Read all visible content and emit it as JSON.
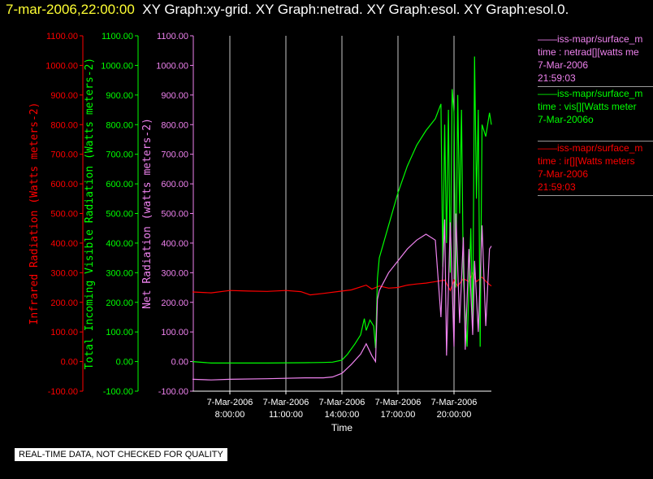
{
  "header": {
    "date_time": "7-mar-2006,22:00:00",
    "graphs": "XY Graph:xy-grid.  XY Graph:netrad.  XY Graph:esol.  XY Graph:esol.0."
  },
  "quality_note": "REAL-TIME DATA, NOT CHECKED FOR QUALITY",
  "legend": [
    {
      "lines": [
        "——iss-mapr/surface_m",
        "time : netrad[][watts me",
        "7-Mar-2006",
        "21:59:03"
      ],
      "color": "#ee82ee"
    },
    {
      "lines": [
        "——iss-mapr/surface_m",
        "time : vis[][Watts meter",
        "7-Mar-2006o"
      ],
      "color": "#00ff00"
    },
    {
      "lines": [
        "——iss-mapr/surface_m",
        "time : ir[][Watts meters",
        "7-Mar-2006",
        "21:59:03"
      ],
      "color": "#ff0000"
    }
  ],
  "chart_data": {
    "type": "line",
    "xlabel": "Time",
    "x_ticks": [
      {
        "hour": 8,
        "date": "7-Mar-2006",
        "time": "8:00:00"
      },
      {
        "hour": 11,
        "date": "7-Mar-2006",
        "time": "11:00:00"
      },
      {
        "hour": 14,
        "date": "7-Mar-2006",
        "time": "14:00:00"
      },
      {
        "hour": 17,
        "date": "7-Mar-2006",
        "time": "17:00:00"
      },
      {
        "hour": 20,
        "date": "7-Mar-2006",
        "time": "20:00:00"
      }
    ],
    "xlim": [
      6.0,
      22.0
    ],
    "grid_x": true,
    "axes": [
      {
        "id": "ir",
        "label": "Infrared Radiation (Watts meters-2)",
        "color": "#ff0000",
        "ylim": [
          -100,
          1100
        ],
        "ticks": [
          "-100.00",
          "0.00",
          "100.00",
          "200.00",
          "300.00",
          "400.00",
          "500.00",
          "600.00",
          "700.00",
          "800.00",
          "900.00",
          "1000.00",
          "1100.00"
        ]
      },
      {
        "id": "vis",
        "label": "Total Incoming Visible Radiation (Watts meters-2)",
        "color": "#00ff00",
        "ylim": [
          -100,
          1100
        ],
        "ticks": [
          "-100.00",
          "0.00",
          "100.00",
          "200.00",
          "300.00",
          "400.00",
          "500.00",
          "600.00",
          "700.00",
          "800.00",
          "900.00",
          "1000.00",
          "1100.00"
        ]
      },
      {
        "id": "netrad",
        "label": "Net Radiation (watts meters-2)",
        "color": "#ee82ee",
        "ylim": [
          -100,
          1100
        ],
        "ticks": [
          "-100.00",
          "0.00",
          "100.00",
          "200.00",
          "300.00",
          "400.00",
          "500.00",
          "600.00",
          "700.00",
          "800.00",
          "900.00",
          "1000.00",
          "1100.00"
        ]
      }
    ],
    "series": [
      {
        "name": "ir",
        "color": "#ff0000",
        "x": [
          6.0,
          7.0,
          8.0,
          9.0,
          10.0,
          11.0,
          11.8,
          12.3,
          13.0,
          14.0,
          14.5,
          15.0,
          15.3,
          15.6,
          16.0,
          16.5,
          17.0,
          17.5,
          18.0,
          18.5,
          19.0,
          19.5,
          19.8,
          20.0,
          20.2,
          20.5,
          20.8,
          21.0,
          21.2,
          21.5,
          21.8,
          22.0
        ],
        "y": [
          235,
          232,
          240,
          238,
          237,
          240,
          236,
          225,
          230,
          238,
          242,
          252,
          258,
          245,
          255,
          248,
          250,
          258,
          262,
          265,
          270,
          275,
          240,
          275,
          255,
          280,
          270,
          300,
          270,
          285,
          265,
          255
        ]
      },
      {
        "name": "vis",
        "color": "#00ff00",
        "x": [
          6.0,
          7.0,
          8.0,
          10.0,
          12.0,
          13.0,
          13.5,
          14.0,
          14.3,
          14.7,
          15.0,
          15.2,
          15.3,
          15.5,
          15.7,
          15.8,
          15.9,
          16.0,
          16.5,
          17.0,
          17.5,
          18.0,
          18.5,
          19.0,
          19.3,
          19.4,
          19.5,
          19.6,
          19.7,
          19.8,
          19.9,
          20.0,
          20.1,
          20.2,
          20.3,
          20.4,
          20.5,
          20.7,
          20.9,
          21.0,
          21.1,
          21.2,
          21.3,
          21.4,
          21.5,
          21.7,
          21.9,
          22.0
        ],
        "y": [
          0,
          -5,
          -5,
          -5,
          -4,
          -3,
          -2,
          5,
          25,
          60,
          90,
          145,
          105,
          140,
          120,
          45,
          280,
          350,
          460,
          570,
          660,
          730,
          780,
          820,
          870,
          320,
          800,
          400,
          850,
          300,
          920,
          840,
          250,
          900,
          500,
          850,
          280,
          50,
          450,
          120,
          1030,
          550,
          850,
          50,
          800,
          760,
          840,
          800
        ]
      },
      {
        "name": "netrad",
        "color": "#ee82ee",
        "x": [
          6.0,
          7.0,
          8.0,
          10.0,
          12.0,
          13.0,
          13.5,
          14.0,
          14.5,
          15.0,
          15.3,
          15.6,
          15.8,
          15.9,
          16.0,
          16.5,
          17.0,
          17.5,
          18.0,
          18.5,
          19.0,
          19.3,
          19.5,
          19.6,
          19.8,
          20.0,
          20.1,
          20.3,
          20.5,
          20.6,
          20.8,
          21.0,
          21.1,
          21.3,
          21.5,
          21.7,
          21.9,
          22.0
        ],
        "y": [
          -60,
          -62,
          -60,
          -58,
          -55,
          -55,
          -52,
          -40,
          -10,
          25,
          60,
          20,
          0,
          210,
          240,
          300,
          340,
          380,
          410,
          430,
          410,
          150,
          480,
          20,
          470,
          50,
          500,
          130,
          420,
          40,
          380,
          90,
          340,
          100,
          460,
          120,
          380,
          390
        ]
      }
    ]
  }
}
